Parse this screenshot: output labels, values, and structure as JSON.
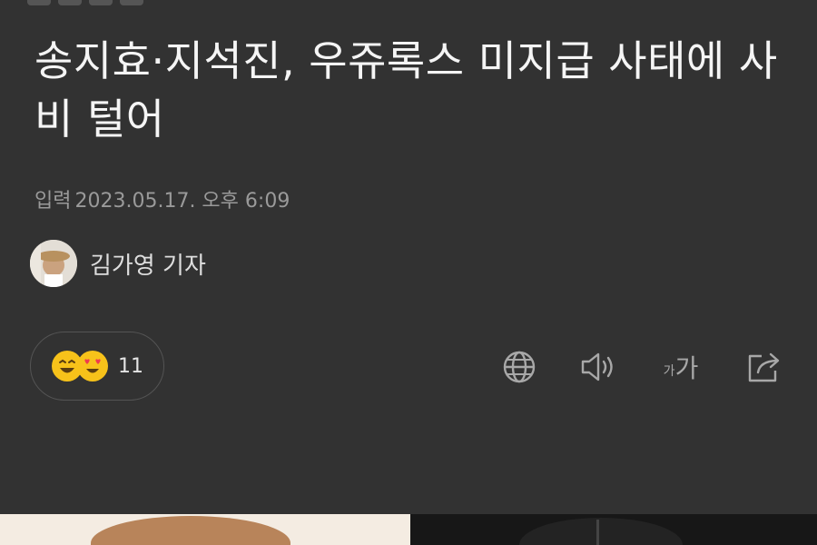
{
  "article": {
    "headline": "송지효·지석진, 우쥬록스 미지급 사태에 사비 털어",
    "published_label": "입력",
    "published_time": "2023.05.17. 오후 6:09",
    "author_name": "김가영 기자"
  },
  "reactions": {
    "count": "11",
    "emojis": [
      "smile-emoji",
      "heart-eyes-emoji"
    ]
  },
  "toolbar": {
    "font_label_small": "가",
    "font_label_large": "가",
    "icons": [
      "globe-icon",
      "speaker-icon",
      "font-size-icon",
      "share-icon"
    ]
  },
  "colors": {
    "background": "#323232",
    "headline": "#f5f5f5",
    "meta": "#9a9a9a",
    "emoji_yellow": "#f7c21a",
    "emoji_red": "#ef3b4e"
  }
}
